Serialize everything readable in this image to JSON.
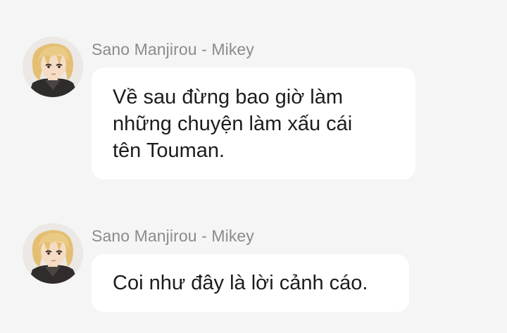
{
  "messages": [
    {
      "sender": "Sano Manjirou - Mikey",
      "avatar_icon": "user-avatar-icon",
      "lines": [
        "Về sau đừng bao giờ làm",
        "những chuyện làm xấu cái",
        "tên Touman."
      ]
    },
    {
      "sender": "Sano Manjirou - Mikey",
      "avatar_icon": "user-avatar-icon",
      "lines": [
        "Coi như đây là lời cảnh cáo."
      ]
    }
  ],
  "colors": {
    "background": "#f5f5f5",
    "bubble": "#ffffff",
    "sender_text": "#8b8b8b",
    "message_text": "#1c1c1c"
  }
}
